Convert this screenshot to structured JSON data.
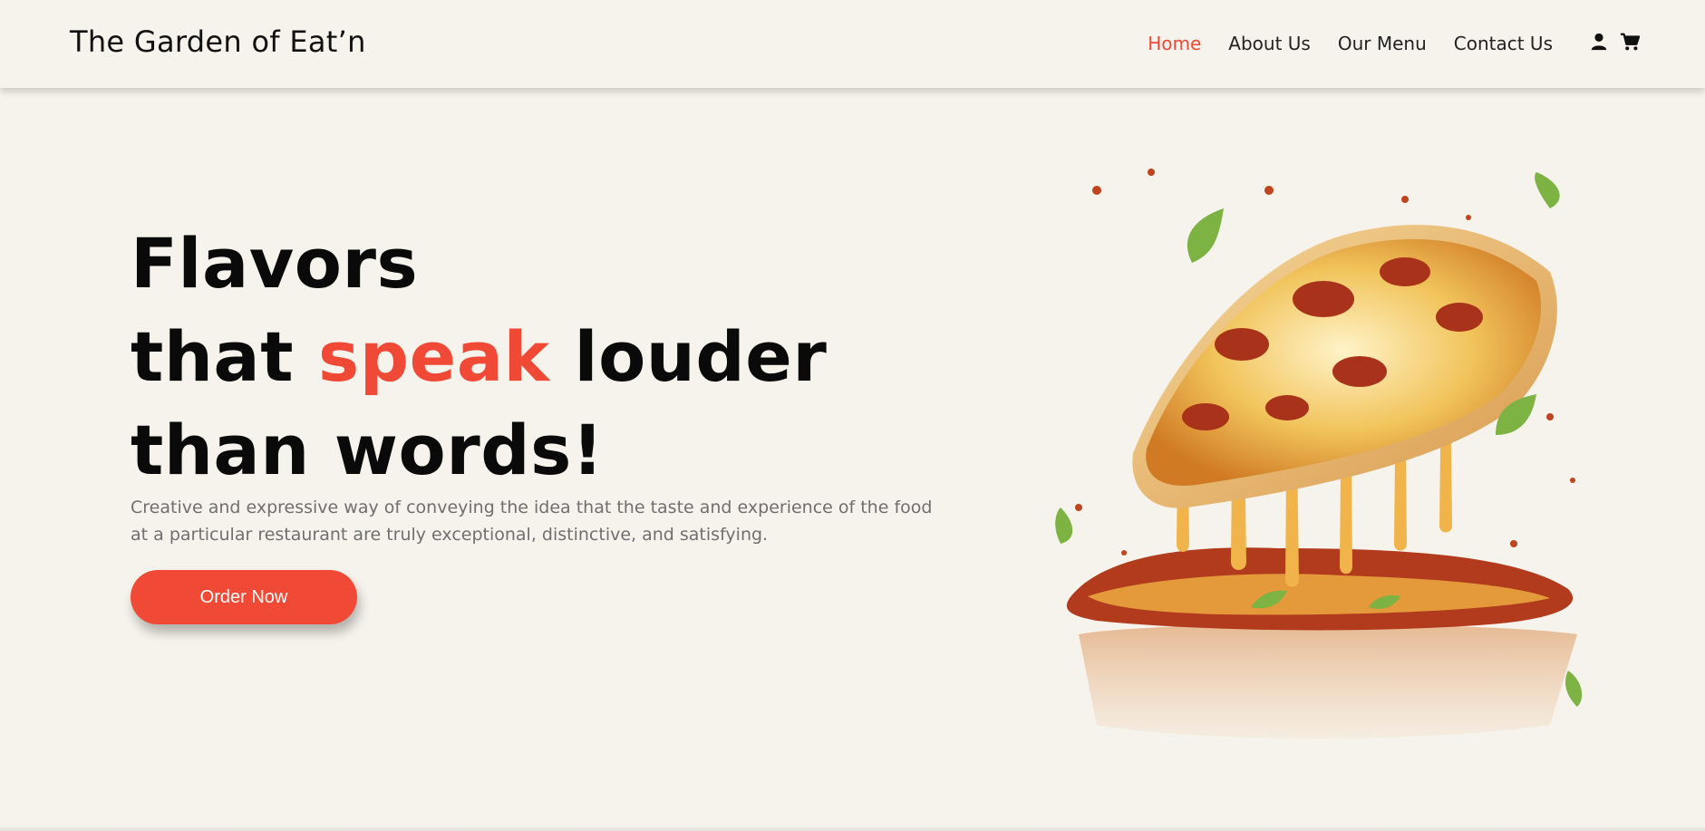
{
  "header": {
    "brand": "The Garden of Eat’n",
    "nav": [
      {
        "label": "Home",
        "active": true
      },
      {
        "label": "About Us"
      },
      {
        "label": "Our Menu"
      },
      {
        "label": "Contact Us"
      }
    ],
    "icons": [
      "user-icon",
      "cart-icon"
    ]
  },
  "hero": {
    "line1": "Flavors",
    "line2_start": "that",
    "line2_accent": "speak",
    "line2_end": "louder",
    "line3": "than words!",
    "description": "Creative and expressive way of conveying the idea that the taste and experience of the food at a particular restaurant are truly exceptional, distinctive, and satisfying.",
    "cta": "Order Now",
    "image": "pizza-slice-illustration"
  },
  "colors": {
    "accent": "#f04a36",
    "background": "#f6f3ec",
    "text": "#0a0a0a",
    "muted": "#6f6f6f"
  }
}
